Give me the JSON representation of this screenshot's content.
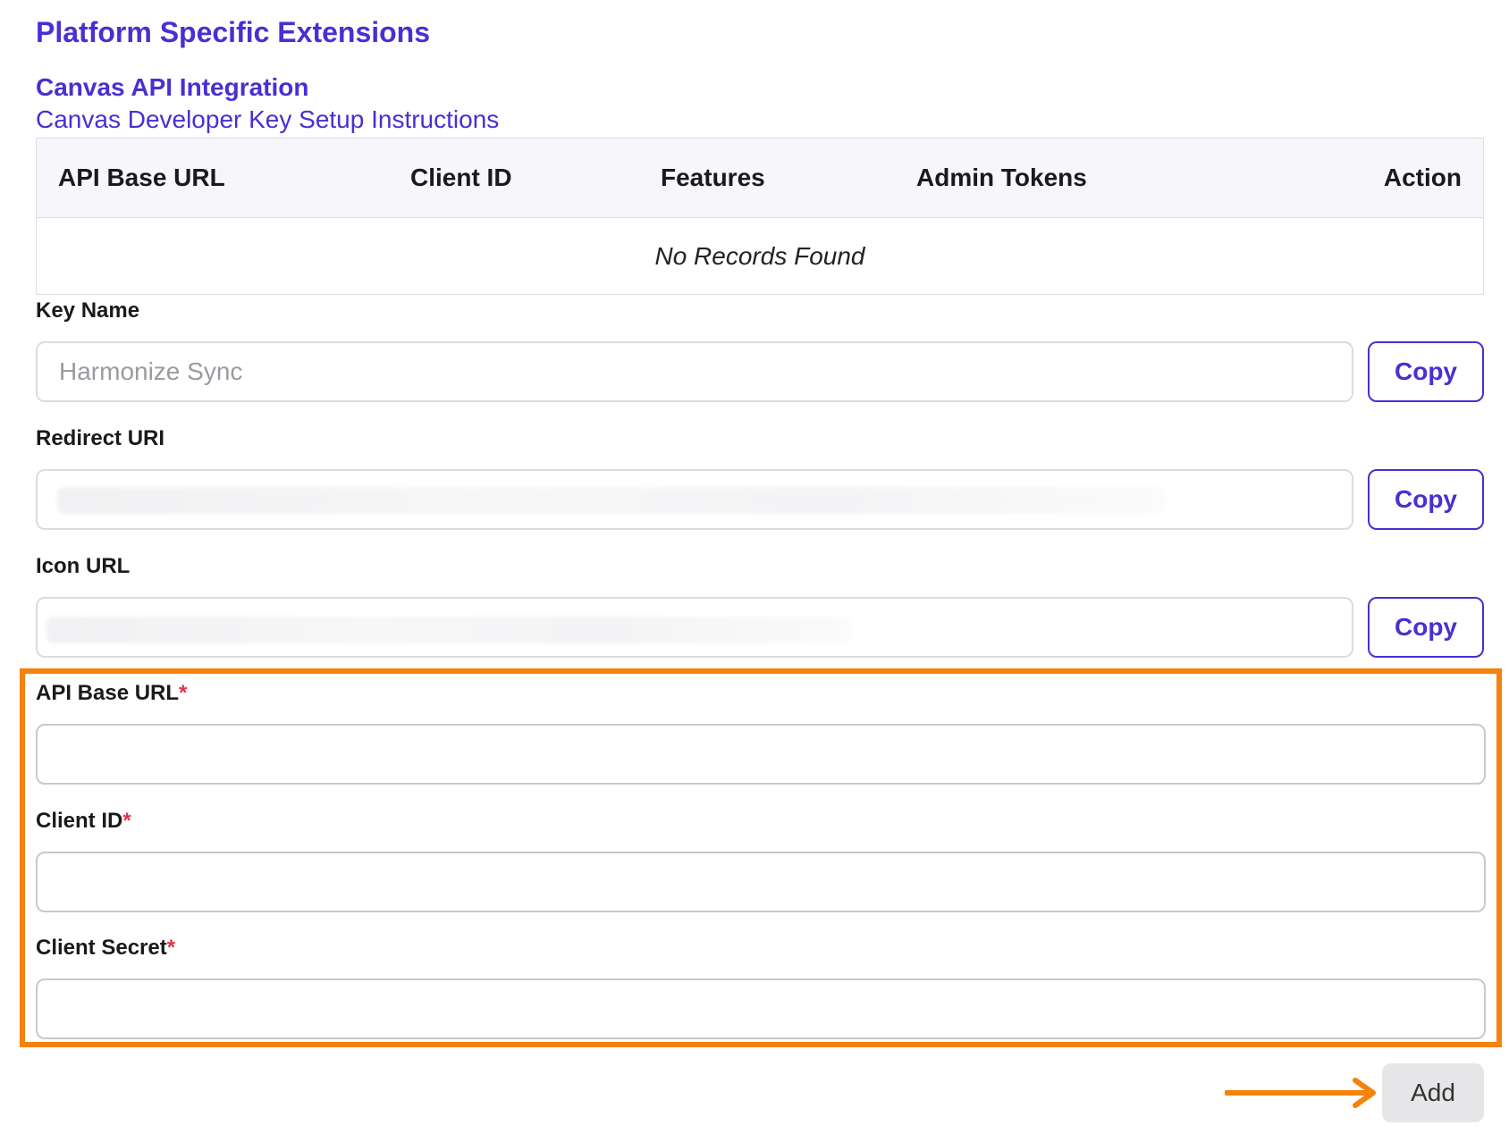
{
  "header": {
    "section_title": "Platform Specific Extensions",
    "integration_title": "Canvas API Integration",
    "setup_link": "Canvas Developer Key Setup Instructions"
  },
  "table": {
    "columns": [
      "API Base URL",
      "Client ID",
      "Features",
      "Admin Tokens",
      "Action"
    ],
    "empty_message": "No Records Found"
  },
  "copy_fields": {
    "key_name": {
      "label": "Key Name",
      "placeholder": "Harmonize Sync",
      "value": "",
      "button": "Copy"
    },
    "redirect_uri": {
      "label": "Redirect URI",
      "value": "",
      "button": "Copy"
    },
    "icon_url": {
      "label": "Icon URL",
      "value": "",
      "button": "Copy"
    }
  },
  "form": {
    "api_base_url": {
      "label": "API Base URL",
      "required_mark": "*",
      "value": ""
    },
    "client_id": {
      "label": "Client ID",
      "required_mark": "*",
      "value": ""
    },
    "client_secret": {
      "label": "Client Secret",
      "required_mark": "*",
      "value": ""
    },
    "add_button": "Add"
  },
  "colors": {
    "brand": "#4a2fd1",
    "highlight": "#f5820b",
    "required": "#e0324a",
    "disabled_button": "#e6e6e8"
  }
}
